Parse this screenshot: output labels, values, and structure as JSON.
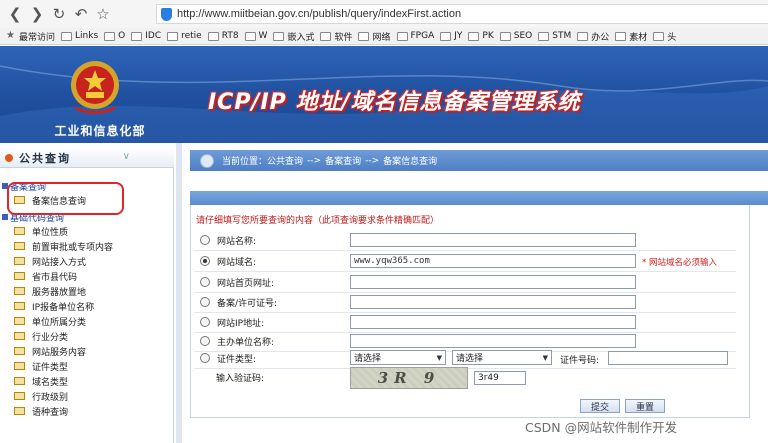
{
  "browser": {
    "url": "http://www.miitbeian.gov.cn/publish/query/indexFirst.action",
    "bookmarks": [
      "最常访问",
      "Links",
      "O",
      "IDC",
      "retie",
      "RT8",
      "W",
      "嵌入式",
      "软件",
      "网络",
      "FPGA",
      "JY",
      "PK",
      "SEO",
      "STM",
      "办公",
      "素材",
      "头"
    ]
  },
  "banner": {
    "ministry": "工业和信息化部",
    "title": "ICP/IP 地址/域名信息备案管理系统"
  },
  "sidebar": {
    "header": "公共查询",
    "group1": "备案查询",
    "group1_items": [
      "备案信息查询"
    ],
    "group2": "基础代码查询",
    "group2_items": [
      "单位性质",
      "前置审批或专项内容",
      "网站接入方式",
      "省市县代码",
      "服务器放置地",
      "IP报备单位名称",
      "单位所属分类",
      "行业分类",
      "网站服务内容",
      "证件类型",
      "域名类型",
      "行政级别",
      "语种查询"
    ]
  },
  "breadcrumb": {
    "prefix": "当前位置：公共查询",
    "sep1": "-->",
    "level2": "备案查询",
    "sep2": "-->",
    "level3": "备案信息查询"
  },
  "form": {
    "notice": "请仔细填写您所要查询的内容（此项查询要求条件精确匹配）",
    "fields": [
      {
        "label": "网站名称:",
        "value": ""
      },
      {
        "label": "网站域名:",
        "value": "www.yqw365.com",
        "note": "* 网站域名必须输入"
      },
      {
        "label": "网站首页网址:",
        "value": ""
      },
      {
        "label": "备案/许可证号:",
        "value": ""
      },
      {
        "label": "网站IP地址:",
        "value": ""
      },
      {
        "label": "主办单位名称:",
        "value": ""
      },
      {
        "label": "证件类型:"
      }
    ],
    "select1": "请选择",
    "select2": "请选择",
    "cert_no_label": "证件号码:",
    "captcha_label": "输入验证码:",
    "captcha_image_text": "3R 9",
    "captcha_value": "3r49",
    "submit": "提交",
    "reset": "重置"
  },
  "watermark": "CSDN @网站软件制作开发",
  "colors": {
    "banner": "#2f64b8",
    "highlight": "#e0262b",
    "required": "#d21f1f"
  }
}
